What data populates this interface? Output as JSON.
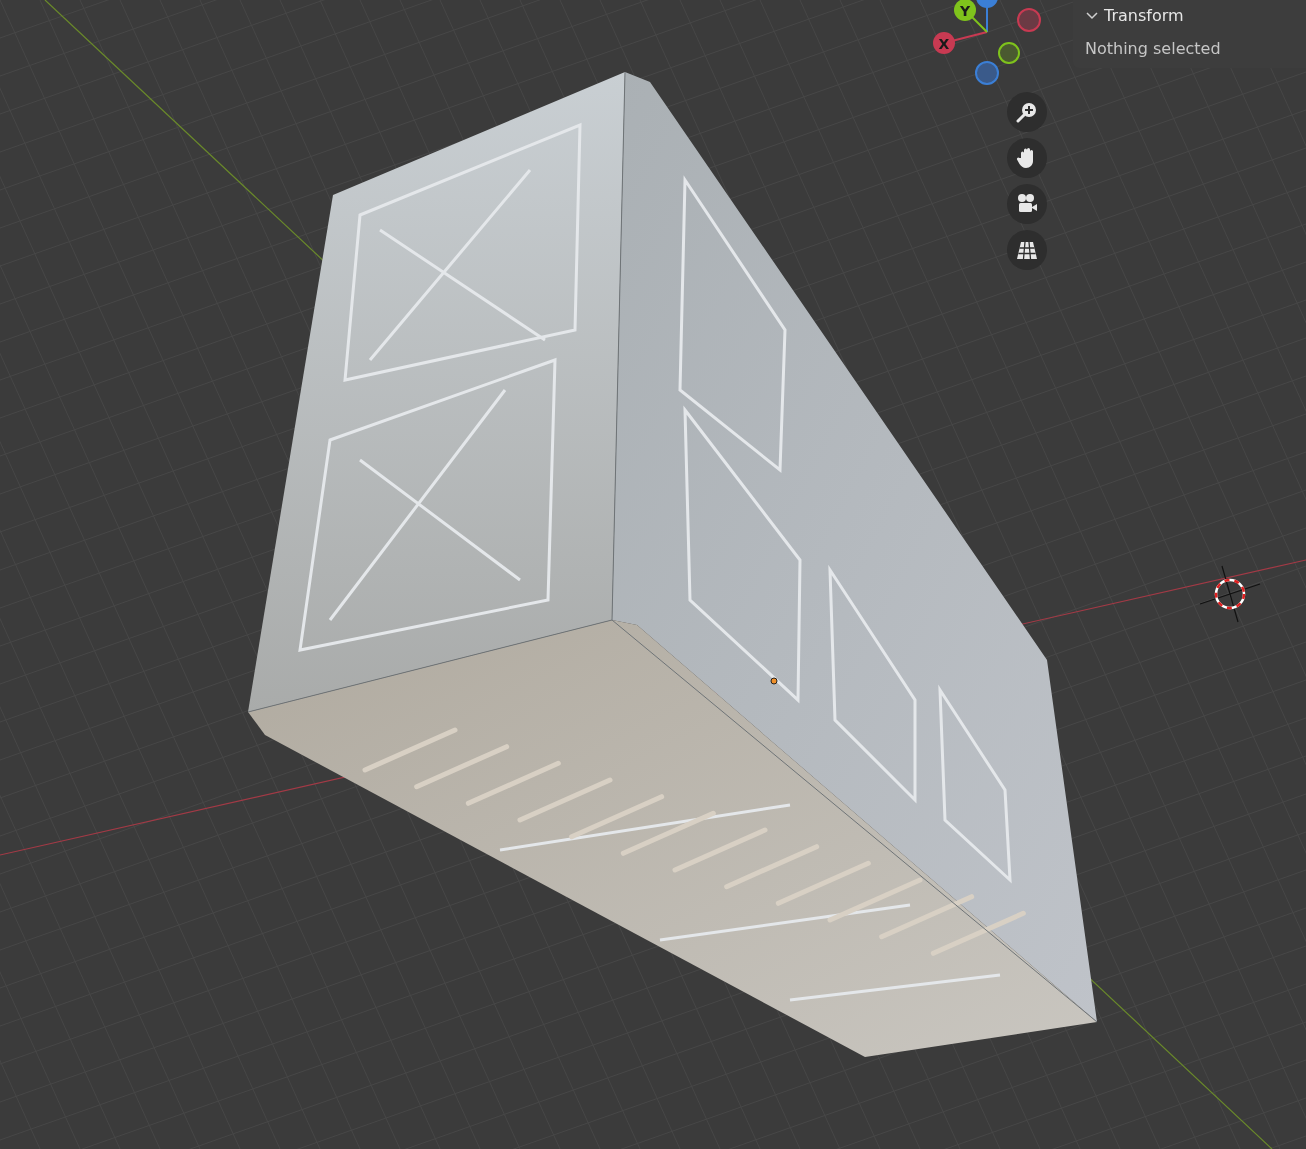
{
  "gizmo": {
    "axes": [
      {
        "label": "X",
        "color": "#c83a52"
      },
      {
        "label": "Y",
        "color": "#7fc31c"
      }
    ]
  },
  "nav_buttons": [
    {
      "kind": "zoom"
    },
    {
      "kind": "pan"
    },
    {
      "kind": "camera"
    },
    {
      "kind": "ortho"
    }
  ],
  "panel": {
    "title": "Transform",
    "expanded": true,
    "message": "Nothing selected"
  }
}
